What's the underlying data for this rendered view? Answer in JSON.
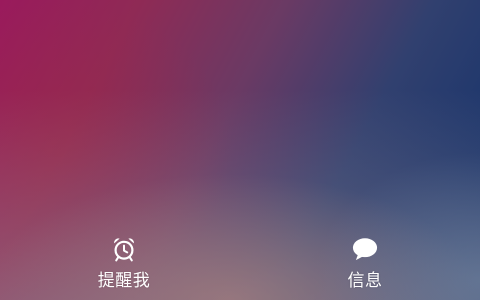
{
  "wallpaper": {
    "colors": {
      "top_left": "#9a1a5c",
      "top_right": "#10306a",
      "bottom_center": "#af827d",
      "bottom_right": "#788ca5"
    }
  },
  "actions": {
    "remind_me": {
      "label": "提醒我",
      "icon": "alarm-clock-icon"
    },
    "message": {
      "label": "信息",
      "icon": "speech-bubble-icon"
    }
  }
}
